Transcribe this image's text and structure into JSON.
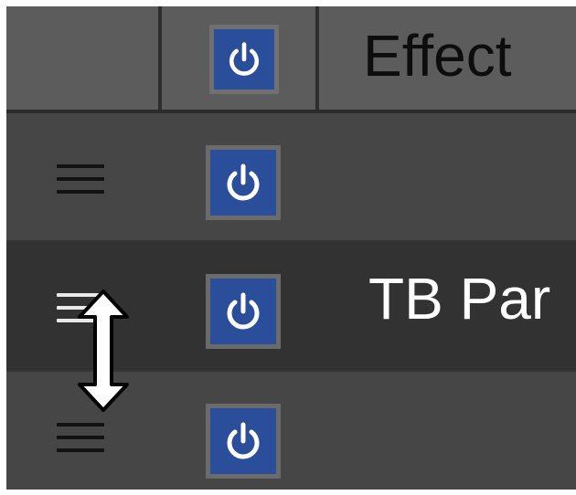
{
  "header": {
    "column_title": "Effect",
    "power_icon": "power-icon"
  },
  "rows": [
    {
      "label": "",
      "drag_icon": "drag-handle-icon",
      "power_icon": "power-icon",
      "selected": false
    },
    {
      "label": "TB Par",
      "drag_icon": "drag-handle-icon",
      "power_icon": "power-icon",
      "selected": true
    },
    {
      "label": "",
      "drag_icon": "drag-handle-icon",
      "power_icon": "power-icon",
      "selected": false
    }
  ],
  "cursor": {
    "icon": "resize-vertical-cursor-icon"
  },
  "colors": {
    "panel_bg": "#464646",
    "header_bg": "#5c5c5c",
    "selected_row_bg": "#323232",
    "power_button_bg": "#2b4e9a",
    "power_button_border": "#6b6b6b"
  }
}
